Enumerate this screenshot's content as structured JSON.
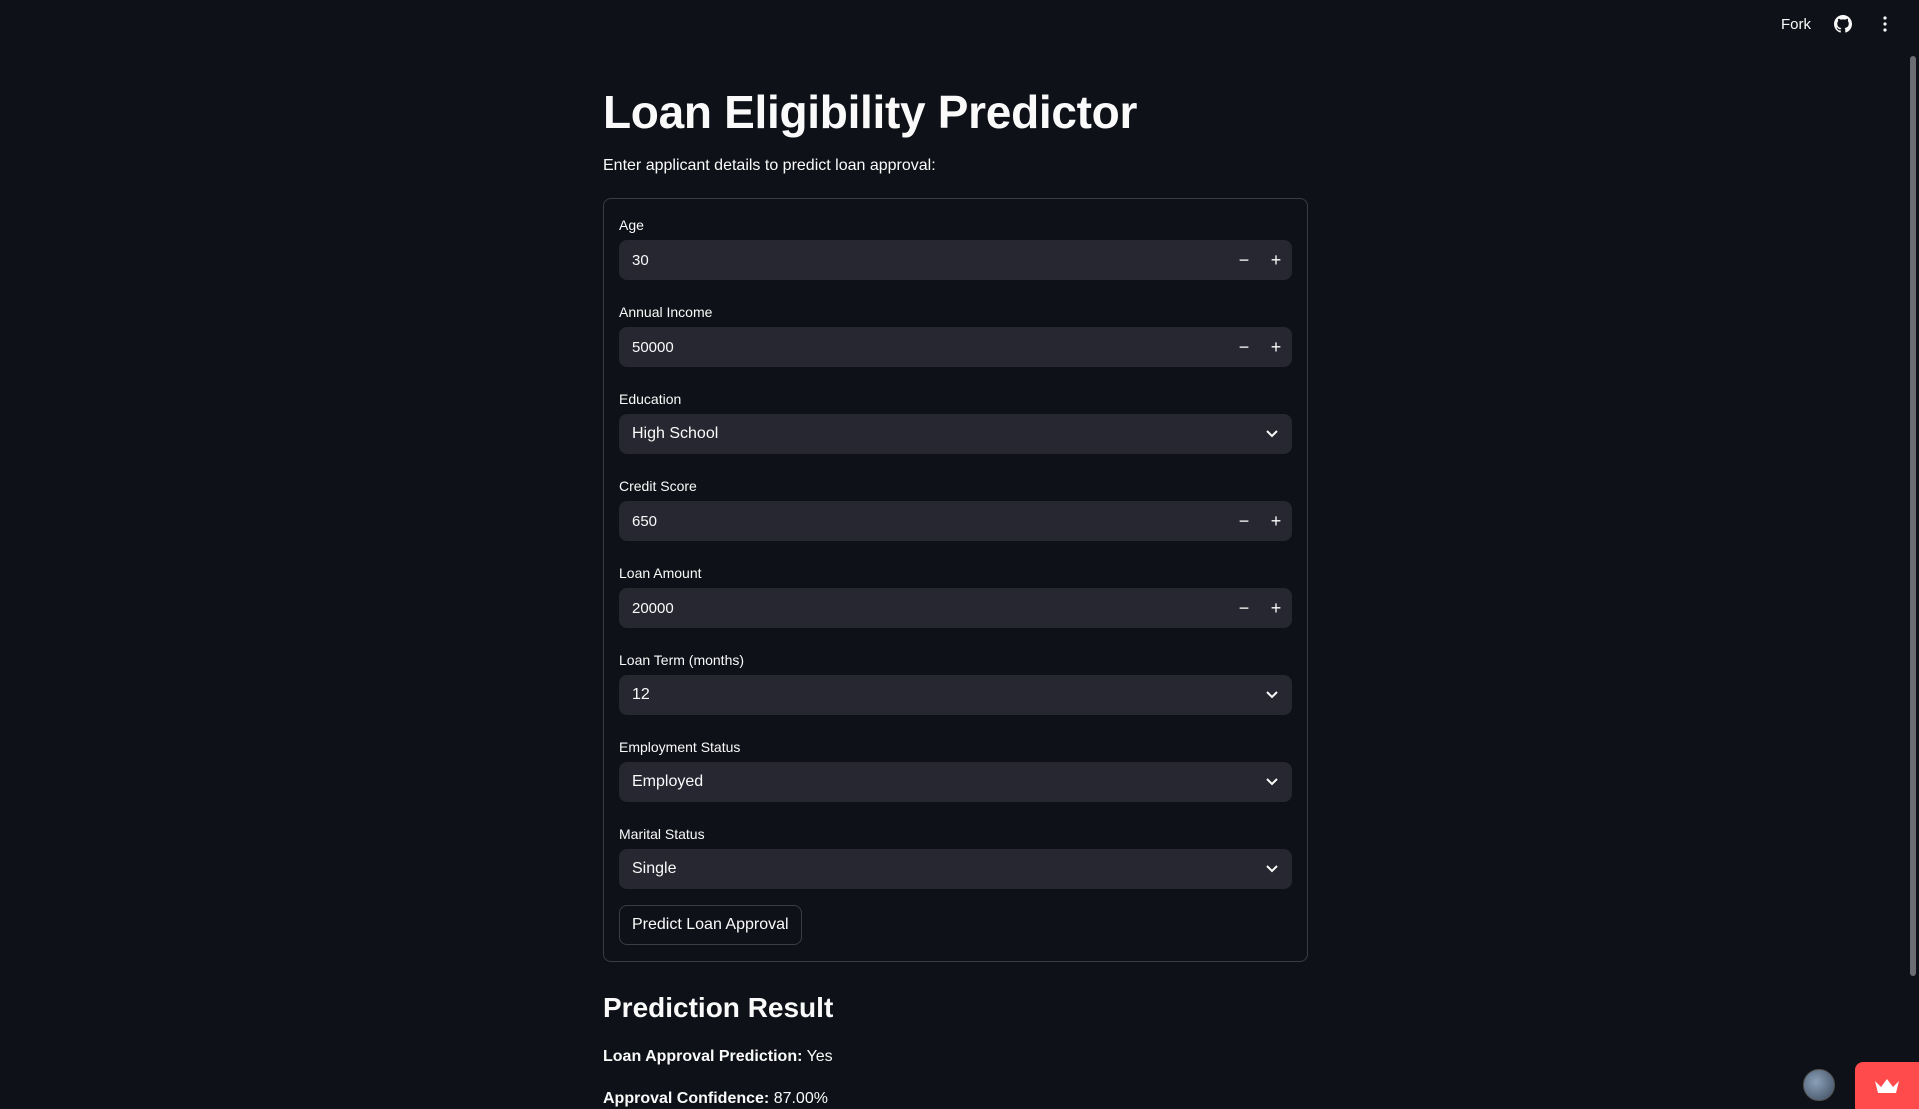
{
  "toolbar": {
    "fork_label": "Fork",
    "github_icon": "github-icon",
    "menu_icon": "more-vertical-icon"
  },
  "page": {
    "title": "Loan Eligibility Predictor",
    "subtitle": "Enter applicant details to predict loan approval:"
  },
  "form": {
    "age": {
      "label": "Age",
      "value": "30"
    },
    "income": {
      "label": "Annual Income",
      "value": "50000"
    },
    "education": {
      "label": "Education",
      "value": "High School"
    },
    "credit_score": {
      "label": "Credit Score",
      "value": "650"
    },
    "loan_amount": {
      "label": "Loan Amount",
      "value": "20000"
    },
    "loan_term": {
      "label": "Loan Term (months)",
      "value": "12"
    },
    "employment": {
      "label": "Employment Status",
      "value": "Employed"
    },
    "marital": {
      "label": "Marital Status",
      "value": "Single"
    },
    "minus": "−",
    "plus": "+",
    "submit_label": "Predict Loan Approval"
  },
  "result": {
    "title": "Prediction Result",
    "prediction_label": "Loan Approval Prediction:",
    "prediction_value": "Yes",
    "confidence_label": "Approval Confidence:",
    "confidence_value": "87.00%"
  },
  "colors": {
    "background": "#0e1117",
    "input_bg": "#262730",
    "accent": "#ff4b4b"
  }
}
